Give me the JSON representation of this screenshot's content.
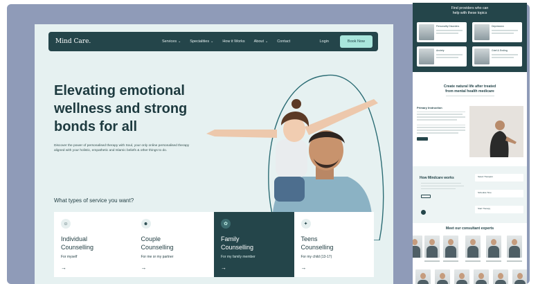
{
  "main": {
    "nav": {
      "logo": "Mind Care.",
      "links": [
        {
          "label": "Services",
          "dropdown": true
        },
        {
          "label": "Specialities",
          "dropdown": true
        },
        {
          "label": "How it Works",
          "dropdown": false
        },
        {
          "label": "About",
          "dropdown": true
        },
        {
          "label": "Contact",
          "dropdown": false
        }
      ],
      "login": "Login",
      "book_now": "Book Now"
    },
    "hero": {
      "title": "Elevating emotional wellness and strong bonds for all",
      "description": "Discover the power of personalised therapy with Soul, your only online personalised therapy aligned with your holistic, empathetic and Islamic beliefs & other things to do."
    },
    "services": {
      "question": "What types of service you want?",
      "cards": [
        {
          "title": "Individual\nCounselling",
          "subtitle": "For myself",
          "icon": "person-icon",
          "active": false
        },
        {
          "title": "Couple\nCounselling",
          "subtitle": "For me or my partner",
          "icon": "couple-icon",
          "active": false
        },
        {
          "title": "Family\nCounselling",
          "subtitle": "For my family member",
          "icon": "family-icon",
          "active": true
        },
        {
          "title": "Teens\nCounselling",
          "subtitle": "For my child (13-17)",
          "icon": "teen-icon",
          "active": false
        }
      ],
      "arrow": "→"
    }
  },
  "right": {
    "providers_title": "Find providers who can\nhelp with these topics",
    "provider_topics": [
      "Personality Disorders",
      "Depression",
      "Anxiety",
      "Grief & Ending"
    ],
    "section2_title": "Create natural life after treated\nfrom mental health medicare",
    "primary_instruction": "Primary Instruction",
    "how_title": "How Mindcare works",
    "how_steps": [
      "Select Therapist",
      "Schedule Time",
      "Start Therapy"
    ],
    "experts_title": "Meet our consultant experts"
  },
  "colors": {
    "brand_dark": "#24454a",
    "accent_mint": "#a9e6dc",
    "hero_bg": "#e6f1f1",
    "frame_bg": "#8f9bb8"
  }
}
